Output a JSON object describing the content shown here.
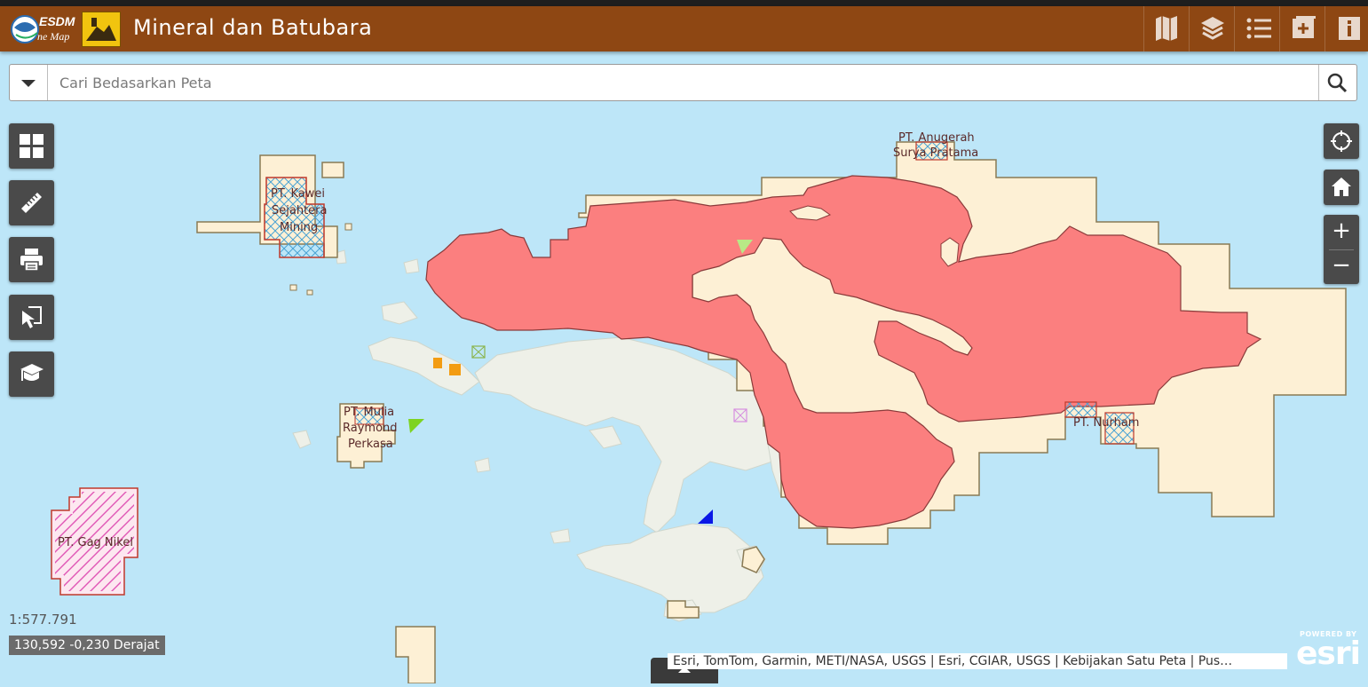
{
  "header": {
    "app_title": "Mineral dan Batubara",
    "logo_text": "ESDM One Map",
    "colors": {
      "bar": "#8e4713"
    },
    "buttons": [
      {
        "name": "basemap-gallery-button",
        "icon": "map-icon"
      },
      {
        "name": "layer-list-button",
        "icon": "layers-icon"
      },
      {
        "name": "legend-button",
        "icon": "list-icon"
      },
      {
        "name": "add-data-button",
        "icon": "add-icon"
      },
      {
        "name": "about-button",
        "icon": "info-icon"
      }
    ]
  },
  "search": {
    "placeholder": "Cari Bedasarkan Peta",
    "value": ""
  },
  "left_tools": [
    {
      "name": "widget-grid-button",
      "icon": "grid-icon"
    },
    {
      "name": "measure-button",
      "icon": "ruler-icon"
    },
    {
      "name": "print-button",
      "icon": "printer-icon"
    },
    {
      "name": "select-button",
      "icon": "select-cursor-icon"
    },
    {
      "name": "education-button",
      "icon": "graduation-cap-icon"
    }
  ],
  "right_tools": [
    {
      "name": "locate-button",
      "icon": "crosshair-icon"
    },
    {
      "name": "home-button",
      "icon": "home-icon"
    }
  ],
  "zoom": {
    "in": "+",
    "out": "−"
  },
  "map_labels": {
    "anugerah": [
      "PT. Anugerah",
      "Surya Pratama"
    ],
    "kawei": [
      "PT. Kawei",
      "Sejahtera",
      "Mining"
    ],
    "mulia": [
      "PT. Mulia",
      "Raymond",
      "Perkasa"
    ],
    "nurham": "PT. Nurham",
    "gag": "PT. Gag Nikel"
  },
  "status": {
    "scale": "1:577.791",
    "coordinates": "130,592 -0,230 Derajat"
  },
  "attribution": "Esri, TomTom, Garmin, METI/NASA, USGS | Esri, CGIAR, USGS | Kebijakan Satu Peta | Pus…",
  "esri_logo": {
    "powered": "POWERED BY",
    "word": "esri"
  },
  "colors": {
    "water": "#bde6f8",
    "land": "#eef0e8",
    "concession_beige": "#fdf0d5",
    "concession_red": "#fb7f7f",
    "outline": "#8a7a55"
  }
}
